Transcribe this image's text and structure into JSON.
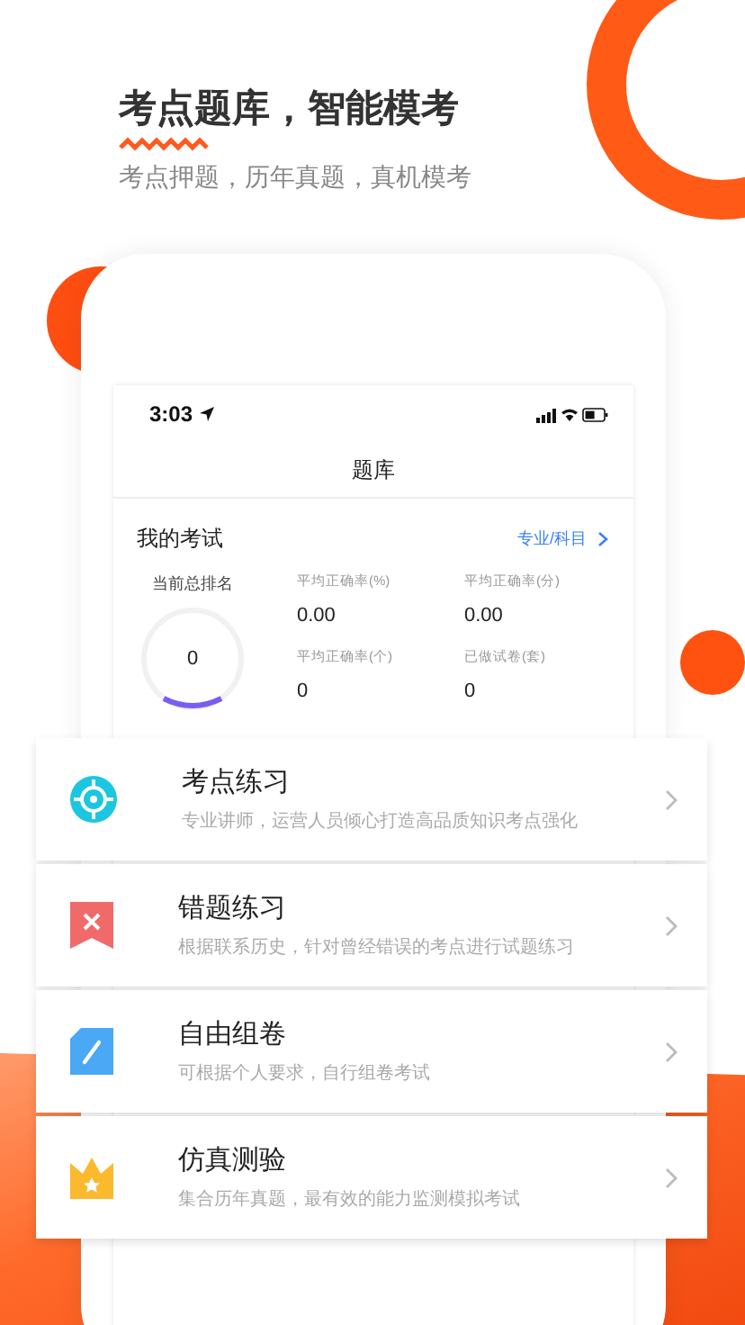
{
  "headline": "考点题库，智能模考",
  "subtitle": "考点押题，历年真题，真机模考",
  "status_bar": {
    "time": "3:03"
  },
  "nav_title": "题库",
  "exam": {
    "title": "我的考试",
    "link": "专业/科目",
    "rank_label": "当前总排名",
    "rank": "0",
    "stats": [
      {
        "label": "平均正确率(%)",
        "value": "0.00"
      },
      {
        "label": "平均正确率(分)",
        "value": "0.00"
      },
      {
        "label": "平均正确率(个)",
        "value": "0"
      },
      {
        "label": "已做试卷(套)",
        "value": "0"
      }
    ]
  },
  "features": [
    {
      "kind": "target",
      "title": "考点练习",
      "description": "专业讲师，运营人员倾心打造高品质知识考点强化"
    },
    {
      "kind": "wrong",
      "title": "错题练习",
      "description": "根据联系历史，针对曾经错误的考点进行试题练习"
    },
    {
      "kind": "compose",
      "title": "自由组卷",
      "description": "可根据个人要求，自行组卷考试"
    },
    {
      "kind": "crown",
      "title": "仿真测验",
      "description": "集合历年真题，最有效的能力监测模拟考试"
    }
  ]
}
